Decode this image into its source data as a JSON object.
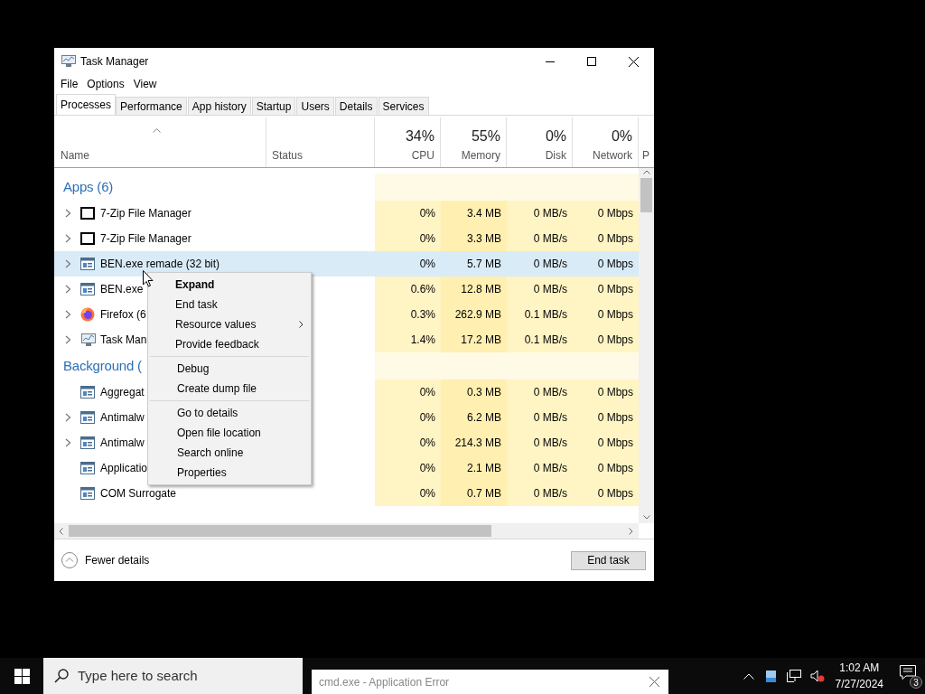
{
  "window": {
    "title": "Task Manager"
  },
  "menu_bar": [
    "File",
    "Options",
    "View"
  ],
  "tabs": [
    {
      "label": "Processes",
      "selected": true
    },
    {
      "label": "Performance",
      "selected": false
    },
    {
      "label": "App history",
      "selected": false
    },
    {
      "label": "Startup",
      "selected": false
    },
    {
      "label": "Users",
      "selected": false
    },
    {
      "label": "Details",
      "selected": false
    },
    {
      "label": "Services",
      "selected": false
    }
  ],
  "columns": [
    {
      "label": "Name"
    },
    {
      "label": "Status"
    },
    {
      "label": "CPU",
      "reading": "34%"
    },
    {
      "label": "Memory",
      "reading": "55%"
    },
    {
      "label": "Disk",
      "reading": "0%"
    },
    {
      "label": "Network",
      "reading": "0%"
    },
    {
      "label": "P"
    }
  ],
  "rows": [
    {
      "kind": "group",
      "name": "Apps (6)"
    },
    {
      "kind": "archive",
      "name": "7-Zip File Manager",
      "expandable": true,
      "selected": false,
      "cpu": "0%",
      "memory": "3.4 MB",
      "disk": "0 MB/s",
      "network": "0 Mbps"
    },
    {
      "kind": "archive",
      "name": "7-Zip File Manager",
      "expandable": true,
      "selected": false,
      "cpu": "0%",
      "memory": "3.3 MB",
      "disk": "0 MB/s",
      "network": "0 Mbps"
    },
    {
      "kind": "app",
      "name": "BEN.exe remade (32 bit)",
      "expandable": true,
      "selected": true,
      "cpu": "0%",
      "memory": "5.7 MB",
      "disk": "0 MB/s",
      "network": "0 Mbps"
    },
    {
      "kind": "app",
      "name": "BEN.exe",
      "expandable": true,
      "selected": false,
      "cpu": "0.6%",
      "memory": "12.8 MB",
      "disk": "0 MB/s",
      "network": "0 Mbps"
    },
    {
      "kind": "firefox",
      "name": "Firefox (6",
      "expandable": true,
      "selected": false,
      "cpu": "0.3%",
      "memory": "262.9 MB",
      "disk": "0.1 MB/s",
      "network": "0 Mbps"
    },
    {
      "kind": "monitor",
      "name": "Task Man",
      "expandable": true,
      "selected": false,
      "cpu": "1.4%",
      "memory": "17.2 MB",
      "disk": "0.1 MB/s",
      "network": "0 Mbps"
    },
    {
      "kind": "group",
      "name": "Background ("
    },
    {
      "kind": "app",
      "name": "Aggregat",
      "expandable": false,
      "selected": false,
      "cpu": "0%",
      "memory": "0.3 MB",
      "disk": "0 MB/s",
      "network": "0 Mbps"
    },
    {
      "kind": "app",
      "name": "Antimalw",
      "expandable": true,
      "selected": false,
      "cpu": "0%",
      "memory": "6.2 MB",
      "disk": "0 MB/s",
      "network": "0 Mbps"
    },
    {
      "kind": "app",
      "name": "Antimalw",
      "expandable": true,
      "selected": false,
      "cpu": "0%",
      "memory": "214.3 MB",
      "disk": "0 MB/s",
      "network": "0 Mbps"
    },
    {
      "kind": "app",
      "name": "Applicatio",
      "expandable": false,
      "selected": false,
      "cpu": "0%",
      "memory": "2.1 MB",
      "disk": "0 MB/s",
      "network": "0 Mbps"
    },
    {
      "kind": "app",
      "name": "COM Surrogate",
      "expandable": false,
      "selected": false,
      "cpu": "0%",
      "memory": "0.7 MB",
      "disk": "0 MB/s",
      "network": "0 Mbps"
    }
  ],
  "context_menu": [
    [
      {
        "label": "Expand",
        "default": true,
        "submenu": false
      },
      {
        "label": "End task",
        "default": false,
        "submenu": false
      },
      {
        "label": "Resource values",
        "default": false,
        "submenu": true
      },
      {
        "label": "Provide feedback",
        "default": false,
        "submenu": false
      }
    ],
    [
      {
        "label": "Debug",
        "default": false,
        "submenu": false
      },
      {
        "label": "Create dump file",
        "default": false,
        "submenu": false
      }
    ],
    [
      {
        "label": "Go to details",
        "default": false,
        "submenu": false
      },
      {
        "label": "Open file location",
        "default": false,
        "submenu": false
      },
      {
        "label": "Search online",
        "default": false,
        "submenu": false
      },
      {
        "label": "Properties",
        "default": false,
        "submenu": false
      }
    ]
  ],
  "footer": {
    "details_link": "Fewer details",
    "end_task_button": "End task"
  },
  "taskbar": {
    "search_placeholder": "Type here to search",
    "preview_title": "cmd.exe - Application Error",
    "time": "1:02 AM",
    "date": "7/27/2024",
    "notification_count": "3"
  }
}
